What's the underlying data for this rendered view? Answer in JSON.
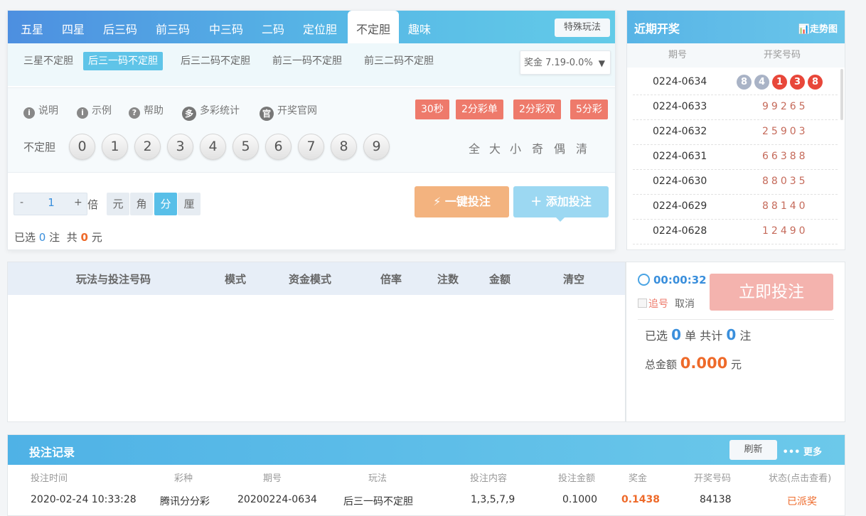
{
  "bet_panel": {
    "tabs": [
      "五星",
      "四星",
      "后三码",
      "前三码",
      "中三码",
      "二码",
      "定位胆",
      "不定胆",
      "趣味"
    ],
    "active_tab": "不定胆",
    "special_label": "特殊玩法",
    "subtabs": [
      "三星不定胆",
      "后三一码不定胆",
      "后三二码不定胆",
      "前三一码不定胆",
      "前三二码不定胆"
    ],
    "active_subtab": "后三一码不定胆",
    "prize_label": "奖金 7.19-0.0%",
    "tools": [
      {
        "icon": "i",
        "label": "说明"
      },
      {
        "icon": "i",
        "label": "示例"
      },
      {
        "icon": "?",
        "label": "帮助"
      },
      {
        "icon": "多",
        "label": "多彩统计"
      },
      {
        "icon": "官",
        "label": "开奖官网"
      }
    ],
    "lottery_chips": [
      "30秒",
      "2分彩单",
      "2分彩双",
      "5分彩"
    ],
    "row_label": "不定胆",
    "numbers": [
      "0",
      "1",
      "2",
      "3",
      "4",
      "5",
      "6",
      "7",
      "8",
      "9"
    ],
    "quick_select": [
      "全",
      "大",
      "小",
      "奇",
      "偶",
      "清"
    ],
    "multiplier": {
      "minus": "-",
      "value": "1",
      "plus": "+",
      "unit_label": "倍"
    },
    "units": [
      "元",
      "角",
      "分",
      "厘"
    ],
    "active_unit": "分",
    "onekey_label": "一键投注",
    "add_label": "添加投注",
    "selected": {
      "prefix": "已选",
      "count": "0",
      "mid": "注",
      "total_prefix": "共",
      "amount": "0",
      "suffix": "元"
    }
  },
  "recent": {
    "title": "近期开奖",
    "trend_label": "走势图",
    "col_period": "期号",
    "col_numbers": "开奖号码",
    "latest": {
      "period": "0224-0634",
      "balls": [
        "8",
        "4",
        "1",
        "3",
        "8"
      ]
    },
    "rows": [
      {
        "period": "0224-0633",
        "numbers": "99265"
      },
      {
        "period": "0224-0632",
        "numbers": "25903"
      },
      {
        "period": "0224-0631",
        "numbers": "66388"
      },
      {
        "period": "0224-0630",
        "numbers": "88035"
      },
      {
        "period": "0224-0629",
        "numbers": "88140"
      },
      {
        "period": "0224-0628",
        "numbers": "12490"
      }
    ],
    "colors": {
      "ball_grey": "#a9b3c6",
      "ball_red": "#e8473a"
    }
  },
  "bet_list": {
    "columns": [
      "玩法与投注号码",
      "模式",
      "资金模式",
      "倍率",
      "注数",
      "金额",
      "清空"
    ]
  },
  "submit": {
    "timer": "00:00:32",
    "chase_label": "追号",
    "cancel_label": "取消",
    "submit_label": "立即投注",
    "sum": {
      "prefix": "已选",
      "bets": "0",
      "mid": "单 共计",
      "count": "0",
      "suffix": "注"
    },
    "total": {
      "prefix": "总金额",
      "amount": "0.000",
      "suffix": "元"
    }
  },
  "records": {
    "title": "投注记录",
    "refresh_label": "刷新",
    "more_label": "更多",
    "columns": [
      "投注时间",
      "彩种",
      "期号",
      "玩法",
      "投注内容",
      "投注金额",
      "奖金",
      "开奖号码",
      "状态(点击查看)"
    ],
    "row": [
      "2020-02-24 10:33:28",
      "腾讯分分彩",
      "20200224-0634",
      "后三一码不定胆",
      "1,3,5,7,9",
      "0.1000",
      "0.1438",
      "84138",
      "已派奖"
    ],
    "colors": {
      "prize": "#ee6a2a",
      "status": "#ee6a2a"
    }
  }
}
